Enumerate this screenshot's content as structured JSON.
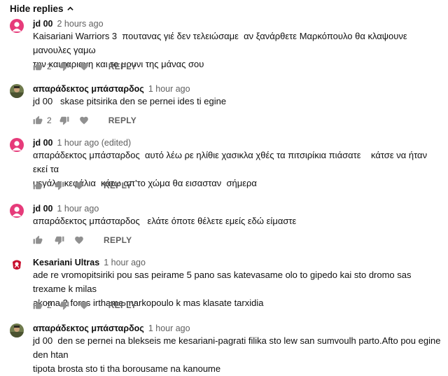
{
  "hide_replies_label": "Hide replies",
  "reply_label": "REPLY",
  "comments": [
    {
      "author": "jd 00",
      "time": "2 hours ago",
      "text": "Kaisariani Warriors 3  πουτανας γιέ δεν τελειώσαμε  αν ξανάρθετε Μαρκόπουλο θα κλαψουνε μανουλες γαμω\nτην καισαριανη και το μουνι της μάνας σου",
      "likes": "2",
      "avatar": "pink-person-avatar"
    },
    {
      "author": "απαράδεκτος μπάσταρδος",
      "time": "1 hour ago",
      "text": "jd 00   skase pitsirika den se pernei ides ti egine",
      "likes": "2",
      "avatar": "photo-avatar"
    },
    {
      "author": "jd 00",
      "time": "1 hour ago (edited)",
      "text": "απαράδεκτος μπάσταρδος  αυτό λέω ρε ηλίθιε χασικλα χθές τα πιτσιρίκια πιάσατε    κάτσε να ήταν εκεί τα\nμεγάλα κεφάλια  κάτω απ'το χώμα θα εισασταν  σήμερα",
      "likes": "",
      "avatar": "pink-person-avatar"
    },
    {
      "author": "jd 00",
      "time": "1 hour ago",
      "text": "απαράδεκτος μπάσταρδος   ελάτε όποτε θέλετε εμείς εδώ είμαστε",
      "likes": "",
      "avatar": "pink-person-avatar"
    },
    {
      "author": "Kesariani Ultras",
      "time": "1 hour ago",
      "text": "ade re vromopitsiriki pou sas peirame 5 pano sas katevasame olo to gipedo kai sto dromo sas trexame k milas\nakoma 2 fores irthame markopoulo k mas klasate tarxidia",
      "likes": "2",
      "avatar": "club-logo-avatar"
    },
    {
      "author": "απαράδεκτος μπάσταρδος",
      "time": "1 hour ago",
      "text": "jd 00  den se pernei na blekseis me kesariani-pagrati filika sto lew san sumvoulh parto.Afto pou egine den htan\ntipota brosta sto ti tha borousame na kanoume",
      "likes": "",
      "avatar": "photo-avatar"
    }
  ],
  "icons": {
    "like": "thumbs-up-icon",
    "dislike": "thumbs-down-icon",
    "heart": "heart-icon",
    "chevron": "chevron-up-icon"
  },
  "colors": {
    "text": "#0f0f0f",
    "secondary": "#606060",
    "avatar_pink": "#e63b7a"
  }
}
